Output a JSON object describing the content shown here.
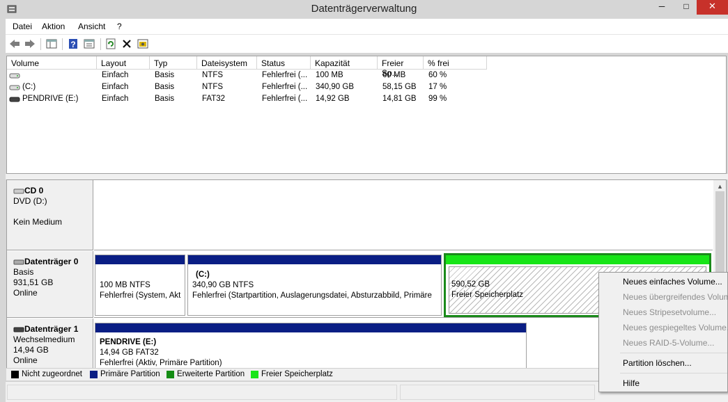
{
  "window": {
    "title": "Datenträgerverwaltung"
  },
  "menu": [
    "Datei",
    "Aktion",
    "Ansicht",
    "?"
  ],
  "toolbar": {
    "icons": [
      "back-arrow-icon",
      "forward-arrow-icon",
      "console-tree-icon",
      "help-icon",
      "properties-icon",
      "refresh-icon",
      "delete-icon",
      "settings-icon"
    ]
  },
  "volumes": {
    "columns": [
      "Volume",
      "Layout",
      "Typ",
      "Dateisystem",
      "Status",
      "Kapazität",
      "Freier Sp...",
      "% frei"
    ],
    "rows": [
      {
        "volume": "",
        "layout": "Einfach",
        "typ": "Basis",
        "fs": "NTFS",
        "status": "Fehlerfrei (...",
        "cap": "100 MB",
        "free": "60 MB",
        "pct": "60 %"
      },
      {
        "volume": "(C:)",
        "layout": "Einfach",
        "typ": "Basis",
        "fs": "NTFS",
        "status": "Fehlerfrei (...",
        "cap": "340,90 GB",
        "free": "58,15 GB",
        "pct": "17 %"
      },
      {
        "volume": "PENDRIVE (E:)",
        "layout": "Einfach",
        "typ": "Basis",
        "fs": "FAT32",
        "status": "Fehlerfrei (...",
        "cap": "14,92 GB",
        "free": "14,81 GB",
        "pct": "99 %"
      }
    ]
  },
  "disks": {
    "cd0": {
      "name": "CD 0",
      "line1": "DVD (D:)",
      "line2": "Kein Medium"
    },
    "disk0": {
      "name": "Datenträger 0",
      "type": "Basis",
      "size": "931,51 GB",
      "state": "Online",
      "parts": [
        {
          "title": "",
          "l1": "100 MB NTFS",
          "l2": "Fehlerfrei (System, Akt"
        },
        {
          "title": "(C:)",
          "l1": "340,90 GB NTFS",
          "l2": "Fehlerfrei (Startpartition, Auslagerungsdatei, Absturzabbild, Primäre"
        },
        {
          "title": "",
          "l1": "590,52 GB",
          "l2": "Freier Speicherplatz"
        }
      ]
    },
    "disk1": {
      "name": "Datenträger 1",
      "type": "Wechselmedium",
      "size": "14,94 GB",
      "state": "Online",
      "parts": [
        {
          "title": "PENDRIVE  (E:)",
          "l1": "14,94 GB FAT32",
          "l2": "Fehlerfrei (Aktiv, Primäre Partition)"
        }
      ]
    }
  },
  "legend": [
    {
      "label": "Nicht zugeordnet",
      "color": "#000000"
    },
    {
      "label": "Primäre Partition",
      "color": "#0a1e84"
    },
    {
      "label": "Erweiterte Partition",
      "color": "#148c14"
    },
    {
      "label": "Freier Speicherplatz",
      "color": "#17e517"
    }
  ],
  "context_menu": [
    {
      "label": "Neues einfaches Volume...",
      "enabled": true
    },
    {
      "label": "Neues übergreifendes Volume...",
      "enabled": false
    },
    {
      "label": "Neues Stripesetvolume...",
      "enabled": false
    },
    {
      "label": "Neues gespiegeltes Volume...",
      "enabled": false
    },
    {
      "label": "Neues RAID-5-Volume...",
      "enabled": false
    },
    {
      "label": "Partition löschen...",
      "enabled": true
    },
    {
      "label": "Hilfe",
      "enabled": true
    }
  ]
}
